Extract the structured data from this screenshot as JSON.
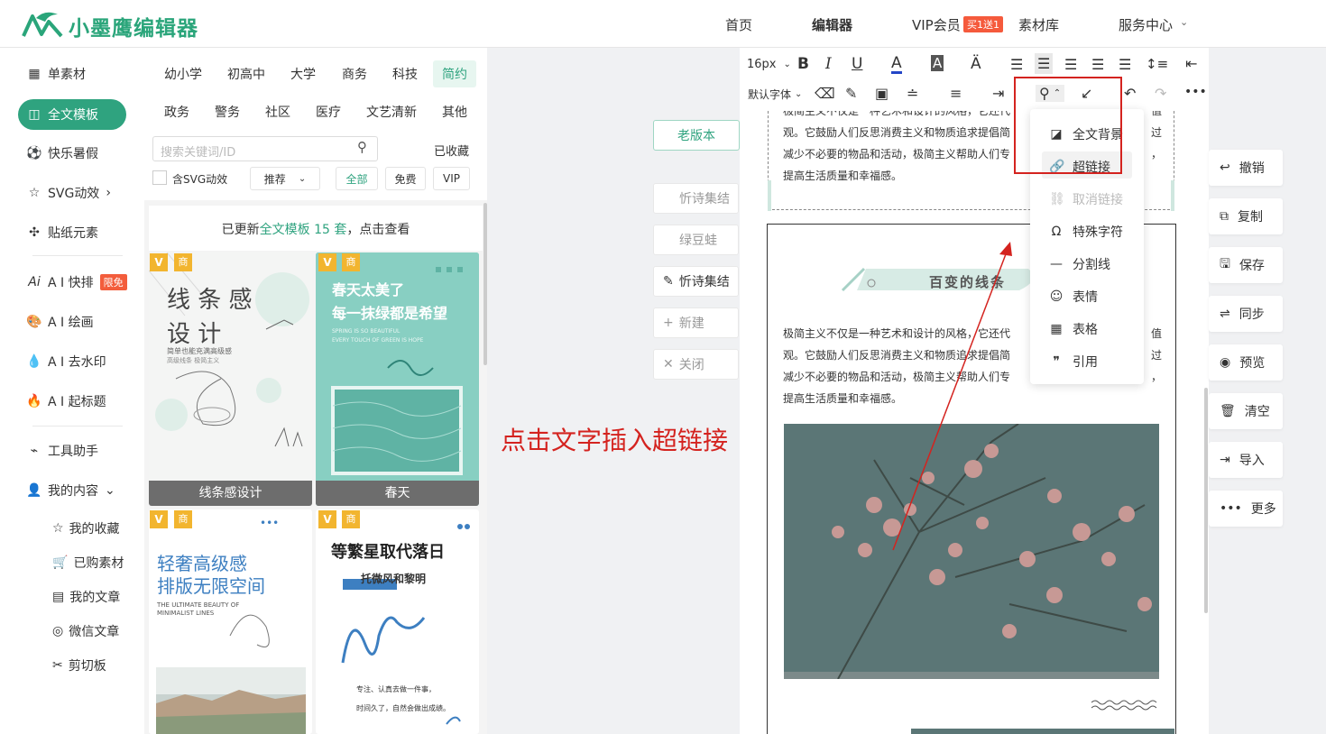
{
  "header": {
    "logo_text": "小墨鹰编辑器",
    "nav": [
      "首页",
      "编辑器",
      "VIP会员",
      "素材库",
      "服务中心"
    ],
    "vip_badge": "买1送1"
  },
  "leftnav": {
    "items": [
      {
        "label": "单素材",
        "icon": "grid-icon"
      },
      {
        "label": "全文模板",
        "icon": "template-icon"
      },
      {
        "label": "快乐暑假",
        "icon": "ball-icon"
      },
      {
        "label": "SVG动效",
        "icon": "star-outline-icon"
      },
      {
        "label": "贴纸元素",
        "icon": "puzzle-icon"
      },
      {
        "label": "A I 快排",
        "icon": "ai-icon",
        "badge": "限免"
      },
      {
        "label": "A I 绘画",
        "icon": "palette-icon"
      },
      {
        "label": "A I 去水印",
        "icon": "drop-icon"
      },
      {
        "label": "A I 起标题",
        "icon": "fire-icon"
      },
      {
        "label": "工具助手",
        "icon": "tools-icon"
      },
      {
        "label": "我的内容",
        "icon": "user-icon"
      }
    ],
    "sub_items": [
      {
        "label": "我的收藏",
        "icon": "star-icon"
      },
      {
        "label": "已购素材",
        "icon": "cart-icon"
      },
      {
        "label": "我的文章",
        "icon": "document-icon"
      },
      {
        "label": "微信文章",
        "icon": "wechat-icon"
      },
      {
        "label": "剪切板",
        "icon": "scissors-icon"
      }
    ]
  },
  "templates": {
    "categories_row1": [
      "幼小学",
      "初高中",
      "大学",
      "商务",
      "科技",
      "简约"
    ],
    "categories_row2": [
      "政务",
      "警务",
      "社区",
      "医疗",
      "文艺清新",
      "其他"
    ],
    "search_placeholder": "搜索关键词/ID",
    "collected": "已收藏",
    "svg_filter": "含SVG动效",
    "sort": "推荐",
    "price_filters": [
      "全部",
      "免费",
      "VIP"
    ],
    "updated_prefix": "已更新",
    "updated_link": "全文模板 15 套",
    "updated_suffix": "，点击查看",
    "tag_v": "V",
    "tag_shang": "商",
    "cards": [
      {
        "label": "线条感设计",
        "title1": "线 条 感",
        "title2": "设   计",
        "sub1": "简单也能充满高级感",
        "sub2": "高级线条 极简主义"
      },
      {
        "label": "春天",
        "title1": "春天太美了",
        "title2": "每一抹绿都是希望",
        "sub1": "SPRING IS SO BEAUTIFUL",
        "sub2": "EVERY TOUCH OF GREEN IS HOPE"
      },
      {
        "title1": "轻奢高级感",
        "title2": "排版无限空间",
        "sub1": "THE ULTIMATE BEAUTY OF",
        "sub2": "MINIMALIST LINES",
        "menu": "•••"
      },
      {
        "title1": "等繁星取代落日",
        "title2": "托微风和黎明",
        "sub1": "专注、认真去做一件事，",
        "sub2": "时间久了，自然会做出成绩。"
      }
    ]
  },
  "middle": {
    "old_version": "老版本",
    "tabs": [
      "忻诗集结",
      "绿豆蛙",
      "忻诗集结"
    ],
    "new": "新建",
    "close": "关闭"
  },
  "toolbar": {
    "font_size": "16px",
    "font_family": "默认字体"
  },
  "dropdown": {
    "items": [
      {
        "label": "全文背景",
        "icon": "background-icon",
        "enabled": true
      },
      {
        "label": "超链接",
        "icon": "link-icon",
        "enabled": true
      },
      {
        "label": "取消链接",
        "icon": "unlink-icon",
        "enabled": false
      },
      {
        "label": "特殊字符",
        "icon": "omega-icon",
        "enabled": true
      },
      {
        "label": "分割线",
        "icon": "line-icon",
        "enabled": true
      },
      {
        "label": "表情",
        "icon": "smile-icon",
        "enabled": true
      },
      {
        "label": "表格",
        "icon": "table-icon",
        "enabled": true
      },
      {
        "label": "引用",
        "icon": "quote-icon",
        "enabled": true
      }
    ]
  },
  "canvas": {
    "para_top": [
      "极简主义不仅是一种艺术和设计的风格，它还代",
      "值",
      "观。它鼓励人们反思消费主义和物质追求提倡简",
      "过",
      "减少不必要的物品和活动，极简主义帮助人们专",
      "，",
      "提高生活质量和幸福感。"
    ],
    "heading": "百变的线条",
    "para": [
      "极简主义不仅是一种艺术和设计的风格，它还代",
      "值",
      "观。它鼓励人们反思消费主义和物质追求提倡简",
      "过",
      "减少不必要的物品和活动，极简主义帮助人们专",
      "，",
      "提高生活质量和幸福感。"
    ]
  },
  "right_tools": [
    "撤销",
    "复制",
    "保存",
    "同步",
    "预览",
    "清空",
    "导入",
    "更多"
  ],
  "annotation": "点击文字插入超链接",
  "colors": {
    "brand": "#2fa37f",
    "highlight": "#d4231f",
    "vip": "#f2b52f"
  }
}
